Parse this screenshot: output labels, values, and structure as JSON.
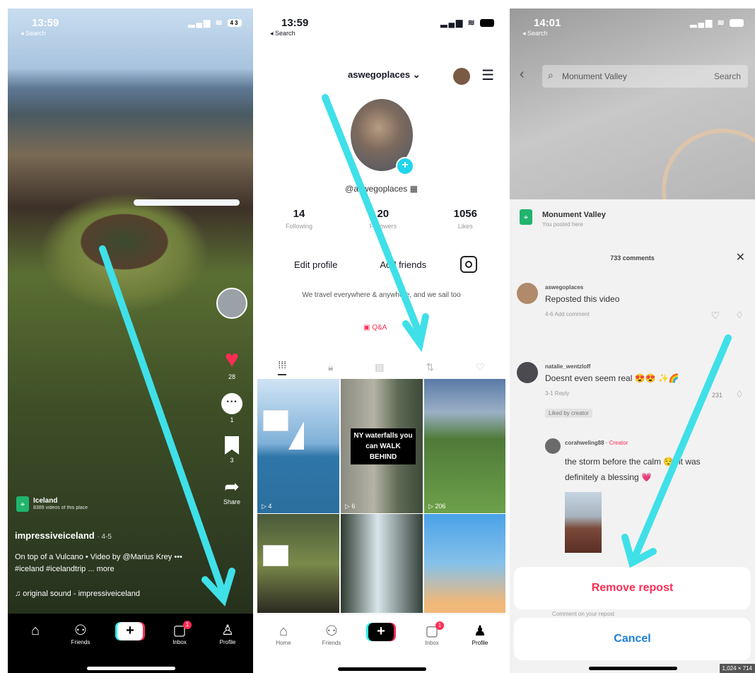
{
  "panel1": {
    "status": {
      "time": "13:59",
      "back": "◂ Search",
      "battery": "43"
    },
    "actions": {
      "likes": "28",
      "comments": "1",
      "saves": "3",
      "share": "Share"
    },
    "location": {
      "name": "Iceland",
      "sub": "8389 videos of this place"
    },
    "user": "impressiveiceland",
    "age": "· 4-5",
    "caption": "On top of a Vulcano • Video by @Marius Krey ••• #iceland #icelandtrip ... more",
    "sound": "♫ original sound - impressiveiceland",
    "nav": [
      {
        "label": ""
      },
      {
        "label": "Friends"
      },
      {
        "label": ""
      },
      {
        "label": "Inbox"
      },
      {
        "label": "Profile"
      }
    ]
  },
  "panel2": {
    "status": {
      "time": "13:59",
      "back": "◂ Search"
    },
    "username": "aswegoplaces",
    "handle": "@aswegoplaces",
    "stats": [
      {
        "num": "14",
        "label": "Following"
      },
      {
        "num": "20",
        "label": "Followers"
      },
      {
        "num": "1056",
        "label": "Likes"
      }
    ],
    "edit_profile": "Edit profile",
    "add_friends": "Add friends",
    "bio": "We travel everywhere & anywhere, and we sail too",
    "qa": "Q&A",
    "tiles": [
      {
        "views": "▷ 4"
      },
      {
        "overlay": "NY waterfalls you can WALK BEHIND",
        "views": "▷ 6"
      },
      {
        "views": "▷ 206"
      },
      {
        "views": ""
      },
      {
        "views": ""
      },
      {
        "views": ""
      }
    ],
    "nav": [
      {
        "label": "Home"
      },
      {
        "label": "Friends"
      },
      {
        "label": ""
      },
      {
        "label": "Inbox"
      },
      {
        "label": "Profile"
      }
    ]
  },
  "panel3": {
    "status": {
      "time": "14:01",
      "back": "◂ Search"
    },
    "search": {
      "query": "Monument Valley",
      "button": "Search"
    },
    "location": {
      "name": "Monument Valley",
      "sub": "You posted here"
    },
    "comments_count": "733 comments",
    "comments": [
      {
        "name": "aswegoplaces",
        "text": "Reposted this video",
        "meta": "4-6   Add comment"
      },
      {
        "name": "natalie_wentzloff",
        "text": "Doesnt even seem real 😍😍 ✨🌈",
        "meta": "3-1   Reply",
        "liked_by": "Liked by creator",
        "likes": "231"
      },
      {
        "name": "corahweling88",
        "creator_tag": "· Creator",
        "text": "the storm before the calm 😌, it was",
        "text2": "definitely a blessing 💗"
      }
    ],
    "remove_repost": "Remove repost",
    "comment_on_repost": "Comment on your repost",
    "cancel": "Cancel",
    "dims": "1,024 × 714"
  }
}
